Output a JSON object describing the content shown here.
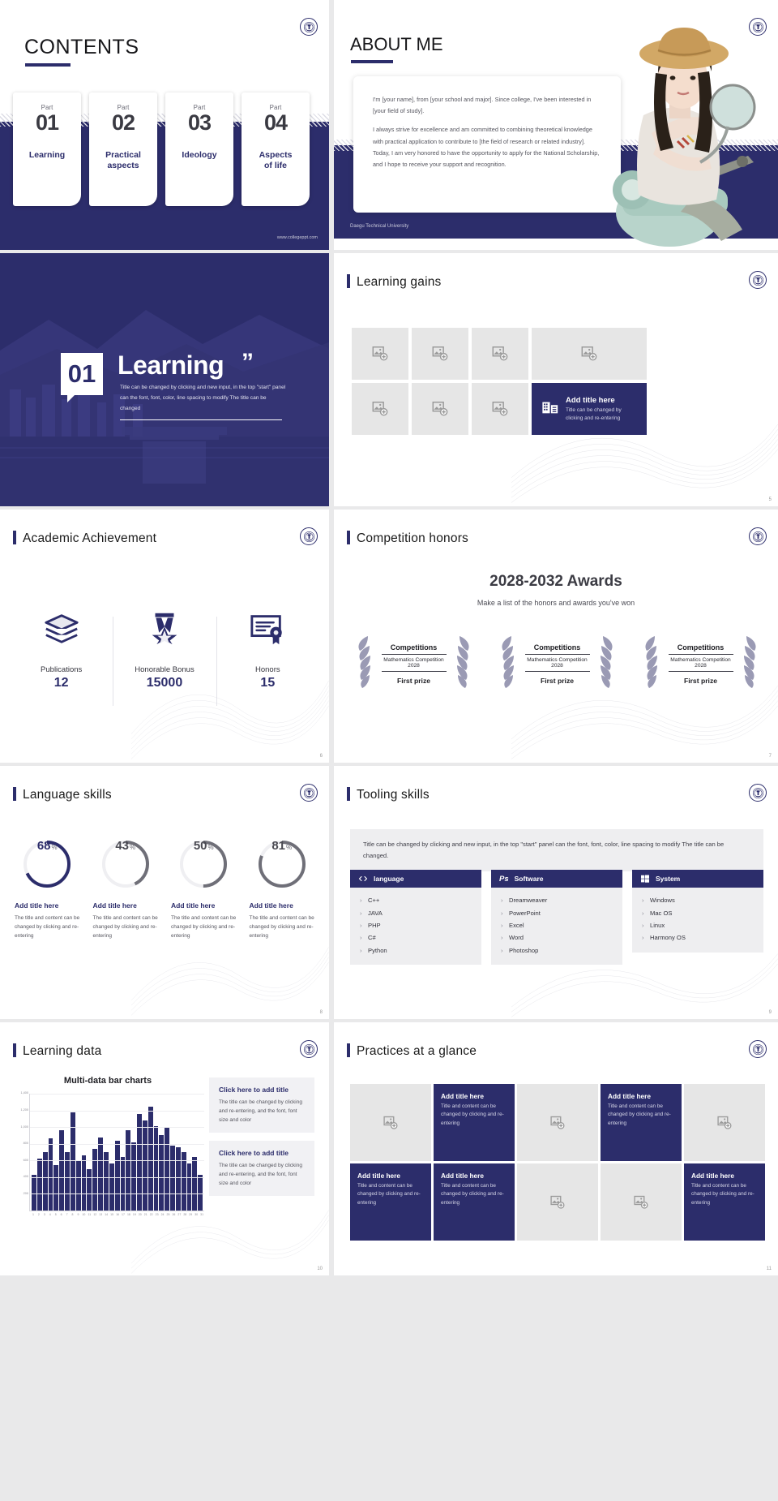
{
  "brand": {
    "navy": "#2c2d6b",
    "grey": "#e6e6e6",
    "accent_text": "#2c2d6b"
  },
  "slide1": {
    "title": "CONTENTS",
    "site": "www.collegeppt.com",
    "cards": [
      {
        "part": "Part",
        "num": "01",
        "label": "Learning"
      },
      {
        "part": "Part",
        "num": "02",
        "label": "Practical\naspects"
      },
      {
        "part": "Part",
        "num": "03",
        "label": "Ideology"
      },
      {
        "part": "Part",
        "num": "04",
        "label": "Aspects\nof life"
      }
    ]
  },
  "slide2": {
    "title": "ABOUT ME",
    "university": "Daegu Technical University",
    "paragraphs": [
      "I'm [your name], from [your school and major]. Since college, I've been interested in [your field of study].",
      "I always strive for excellence and am committed to combining theoretical knowledge with practical application to contribute to [the field of research or related industry]. Today, I am very honored to have the opportunity to apply for the National Scholarship, and I hope to receive your support and recognition."
    ]
  },
  "slide3": {
    "number": "01",
    "heading": "Learning",
    "quote": "”",
    "description": "Title can be changed by clicking and new input, in the top \"start\" panel can the font, font, color, line spacing to modify The title can be changed"
  },
  "slide4": {
    "title": "Learning gains",
    "page": "5",
    "feature": {
      "title": "Add title here",
      "desc": "Title can be changed by clicking and re-entering",
      "icon": "building-icon"
    },
    "placeholders": 7
  },
  "slide5": {
    "title": "Academic Achievement",
    "page": "6",
    "stats": [
      {
        "icon": "books-icon",
        "label": "Publications",
        "value": "12"
      },
      {
        "icon": "medal-icon",
        "label": "Honorable Bonus",
        "value": "15000"
      },
      {
        "icon": "certificate-icon",
        "label": "Honors",
        "value": "15"
      }
    ]
  },
  "slide6": {
    "title": "Competition honors",
    "page": "7",
    "heading": "2028-2032 Awards",
    "subheading": "Make a list of the honors and awards you've won",
    "awards": [
      {
        "t1": "Competitions",
        "t2": "Mathematics Competition",
        "t3": "2028",
        "t4": "First prize"
      },
      {
        "t1": "Competitions",
        "t2": "Mathematics Competition",
        "t3": "2028",
        "t4": "First prize"
      },
      {
        "t1": "Competitions",
        "t2": "Mathematics Competition",
        "t3": "2028",
        "t4": "First prize"
      }
    ]
  },
  "slide7": {
    "title": "Language skills",
    "page": "8",
    "skills": [
      {
        "pct": 68,
        "pct_text": "68",
        "unit": "%",
        "title": "Add title here",
        "desc": "The title and content can be changed by clicking and re-entering",
        "color": "#2c2d6b"
      },
      {
        "pct": 43,
        "pct_text": "43",
        "unit": "%",
        "title": "Add title here",
        "desc": "The title and content can be changed by clicking and re-entering",
        "color": "#6f6f78"
      },
      {
        "pct": 50,
        "pct_text": "50",
        "unit": "%",
        "title": "Add title here",
        "desc": "The title and content can be changed by clicking and re-entering",
        "color": "#6f6f78"
      },
      {
        "pct": 81,
        "pct_text": "81",
        "unit": "%",
        "title": "Add title here",
        "desc": "The title and content can be changed by clicking and re-entering",
        "color": "#6f6f78"
      }
    ]
  },
  "slide8": {
    "title": "Tooling skills",
    "page": "9",
    "note": "Title can be changed by clicking and new input, in the top \"start\" panel can the font, font, color, line spacing to modify The title can be changed.",
    "columns": [
      {
        "icon": "code-icon",
        "header": "language",
        "items": [
          "C++",
          "JAVA",
          "PHP",
          "C#",
          "Python"
        ]
      },
      {
        "icon": "photoshop-icon",
        "header": "Software",
        "items": [
          "Dreamweaver",
          "PowerPoint",
          "Excel",
          "Word",
          "Photoshop"
        ]
      },
      {
        "icon": "windows-icon",
        "header": "System",
        "items": [
          "Windows",
          "Mac OS",
          "Linux",
          "Harmony OS"
        ]
      }
    ]
  },
  "slide9": {
    "title": "Learning data",
    "page": "10",
    "blocks": [
      {
        "bt": "Click here to add title",
        "bd": "The title can be changed by clicking and re-entering, and the font, font size and color"
      },
      {
        "bt": "Click here to add title",
        "bd": "The title can be changed by clicking and re-entering, and the font, font size and color"
      }
    ],
    "chart_data": {
      "type": "bar",
      "title": "Multi-data bar charts",
      "xlabel": "",
      "ylabel": "",
      "ylim": [
        0,
        1400
      ],
      "grid": true,
      "legend": "none",
      "yticks": [
        200,
        400,
        600,
        800,
        1000,
        1200,
        1400
      ],
      "ytick_labels": [
        "200",
        "400",
        "600",
        "800",
        "1,000",
        "1,200",
        "1,400"
      ],
      "categories": [
        "1",
        "2",
        "3",
        "4",
        "5",
        "6",
        "7",
        "8",
        "9",
        "10",
        "11",
        "12",
        "13",
        "14",
        "15",
        "16",
        "17",
        "18",
        "19",
        "20",
        "21",
        "22",
        "23",
        "24",
        "25",
        "26",
        "27",
        "28",
        "29",
        "30",
        "31"
      ],
      "values": [
        430,
        620,
        700,
        870,
        540,
        960,
        700,
        1180,
        600,
        660,
        500,
        740,
        880,
        700,
        560,
        840,
        640,
        960,
        820,
        1160,
        1080,
        1240,
        1010,
        900,
        1000,
        780,
        760,
        700,
        560,
        640,
        430
      ]
    }
  },
  "slide10": {
    "title": "Practices at a glance",
    "page": "11",
    "cells": [
      {
        "kind": "image"
      },
      {
        "kind": "navy",
        "t": "Add title here",
        "d": "Title and content can be changed by clicking and re-entering"
      },
      {
        "kind": "image"
      },
      {
        "kind": "navy",
        "t": "Add title here",
        "d": "Title and content can be changed by clicking and re-entering"
      },
      {
        "kind": "image"
      },
      {
        "kind": "navy",
        "t": "Add title here",
        "d": "Title and content can be changed by clicking and re-entering"
      },
      {
        "kind": "navy",
        "t": "Add title here",
        "d": "Title and content can be changed by clicking and re-entering"
      },
      {
        "kind": "image"
      },
      {
        "kind": "image"
      },
      {
        "kind": "navy",
        "t": "Add title here",
        "d": "Title and content can be changed by clicking and re-entering"
      }
    ]
  }
}
